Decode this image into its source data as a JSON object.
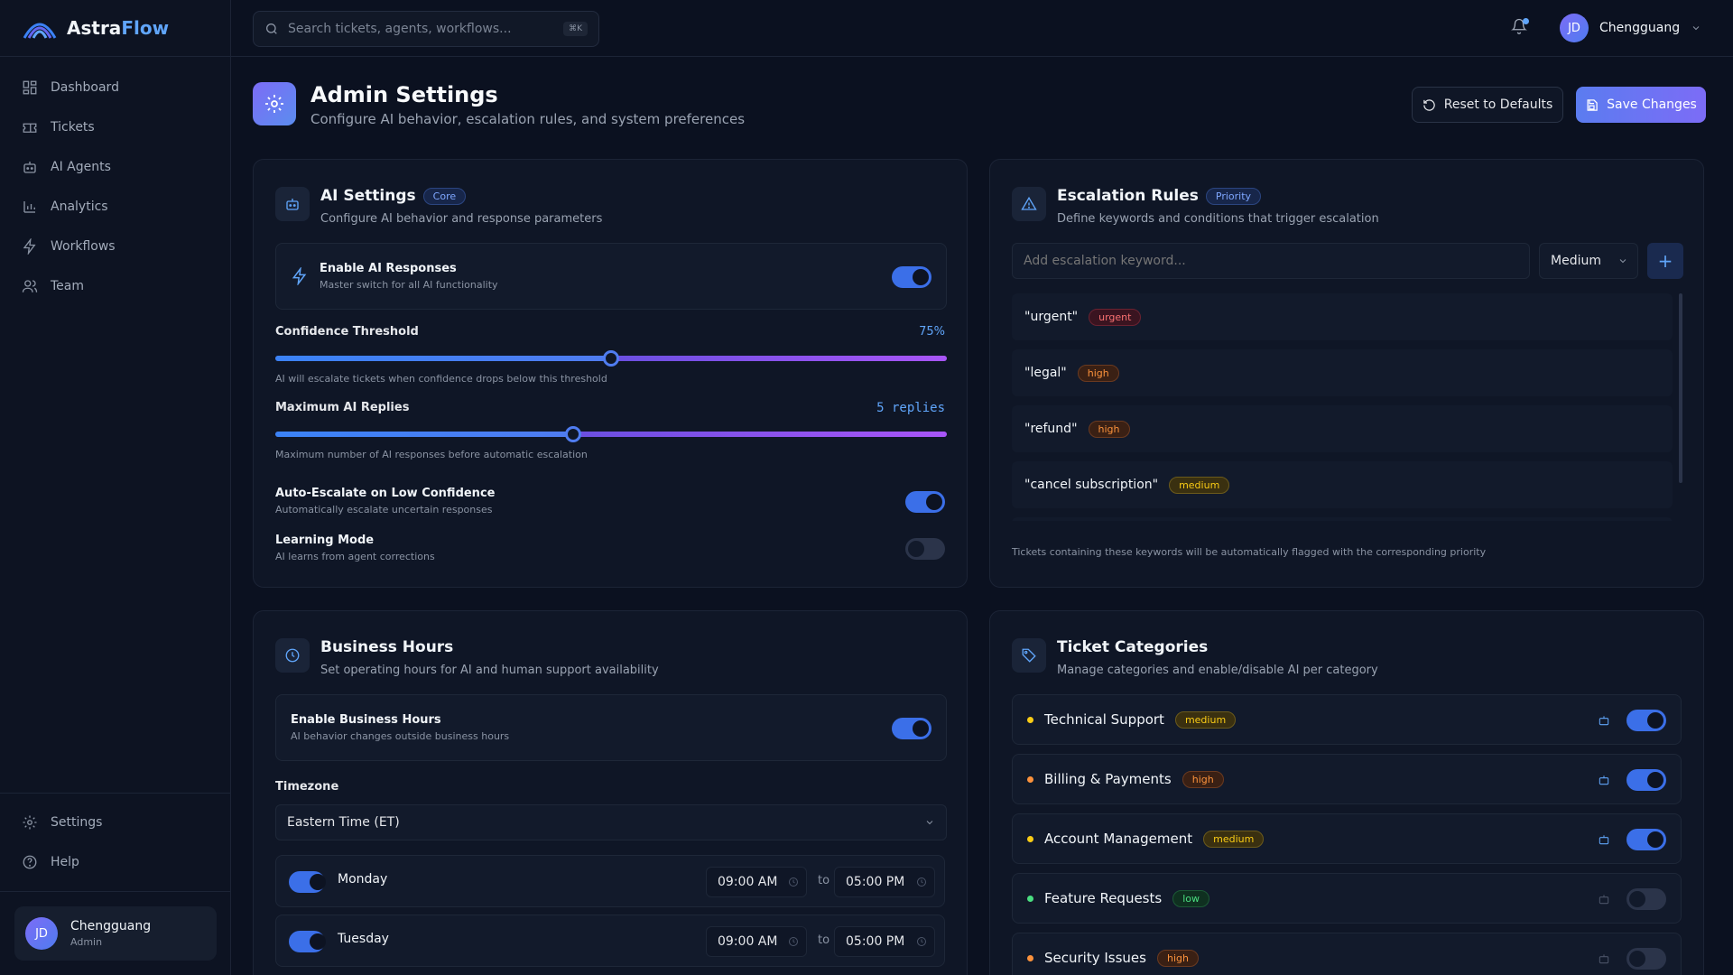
{
  "app": {
    "name_part1": "Astra",
    "name_part2": "Flow"
  },
  "search": {
    "placeholder": "Search tickets, agents, workflows...",
    "shortcut": "⌘K"
  },
  "nav": {
    "items": [
      "Dashboard",
      "Tickets",
      "AI Agents",
      "Analytics",
      "Workflows",
      "Team"
    ],
    "bottom": [
      "Settings",
      "Help"
    ]
  },
  "user": {
    "initials": "JD",
    "name": "Chengguang",
    "role": "Admin"
  },
  "header": {
    "title": "Admin Settings",
    "subtitle": "Configure AI behavior, escalation rules, and system preferences",
    "reset_label": "Reset to Defaults",
    "save_label": "Save Changes"
  },
  "ai_settings": {
    "title": "AI Settings",
    "badge": "Core",
    "subtitle": "Configure AI behavior and response parameters",
    "enable": {
      "title": "Enable AI Responses",
      "desc": "Master switch for all AI functionality",
      "on": true
    },
    "confidence": {
      "label": "Confidence Threshold",
      "value_label": "75%",
      "value": 0.5,
      "desc": "AI will escalate tickets when confidence drops below this threshold"
    },
    "max_replies": {
      "label": "Maximum AI Replies",
      "value_label": "5 replies",
      "value": 0.444,
      "desc": "Maximum number of AI responses before automatic escalation"
    },
    "auto_escalate": {
      "title": "Auto-Escalate on Low Confidence",
      "desc": "Automatically escalate uncertain responses",
      "on": true
    },
    "learning": {
      "title": "Learning Mode",
      "desc": "AI learns from agent corrections",
      "on": false
    }
  },
  "escalation": {
    "title": "Escalation Rules",
    "badge": "Priority",
    "subtitle": "Define keywords and conditions that trigger escalation",
    "input_placeholder": "Add escalation keyword...",
    "priority_select": "Medium",
    "add_label": "+",
    "keywords": [
      {
        "text": "\"urgent\"",
        "priority": "urgent"
      },
      {
        "text": "\"legal\"",
        "priority": "high"
      },
      {
        "text": "\"refund\"",
        "priority": "high"
      },
      {
        "text": "\"cancel subscription\"",
        "priority": "medium"
      }
    ],
    "footnote": "Tickets containing these keywords will be automatically flagged with the corresponding priority"
  },
  "business_hours": {
    "title": "Business Hours",
    "subtitle": "Set operating hours for AI and human support availability",
    "enable": {
      "title": "Enable Business Hours",
      "desc": "AI behavior changes outside business hours",
      "on": true
    },
    "timezone_label": "Timezone",
    "timezone_value": "Eastern Time (ET)",
    "to_label": "to",
    "days": [
      {
        "name": "Monday",
        "start": "09:00 AM",
        "end": "05:00 PM",
        "on": true
      },
      {
        "name": "Tuesday",
        "start": "09:00 AM",
        "end": "05:00 PM",
        "on": true
      }
    ]
  },
  "categories": {
    "title": "Ticket Categories",
    "subtitle": "Manage categories and enable/disable AI per category",
    "items": [
      {
        "name": "Technical Support",
        "priority": "medium",
        "dot": "#facc15",
        "ai_on": true
      },
      {
        "name": "Billing & Payments",
        "priority": "high",
        "dot": "#fb923c",
        "ai_on": true
      },
      {
        "name": "Account Management",
        "priority": "medium",
        "dot": "#facc15",
        "ai_on": true
      },
      {
        "name": "Feature Requests",
        "priority": "low",
        "dot": "#4ade80",
        "ai_on": false
      },
      {
        "name": "Security Issues",
        "priority": "high",
        "dot": "#fb923c",
        "ai_on": false
      }
    ]
  }
}
